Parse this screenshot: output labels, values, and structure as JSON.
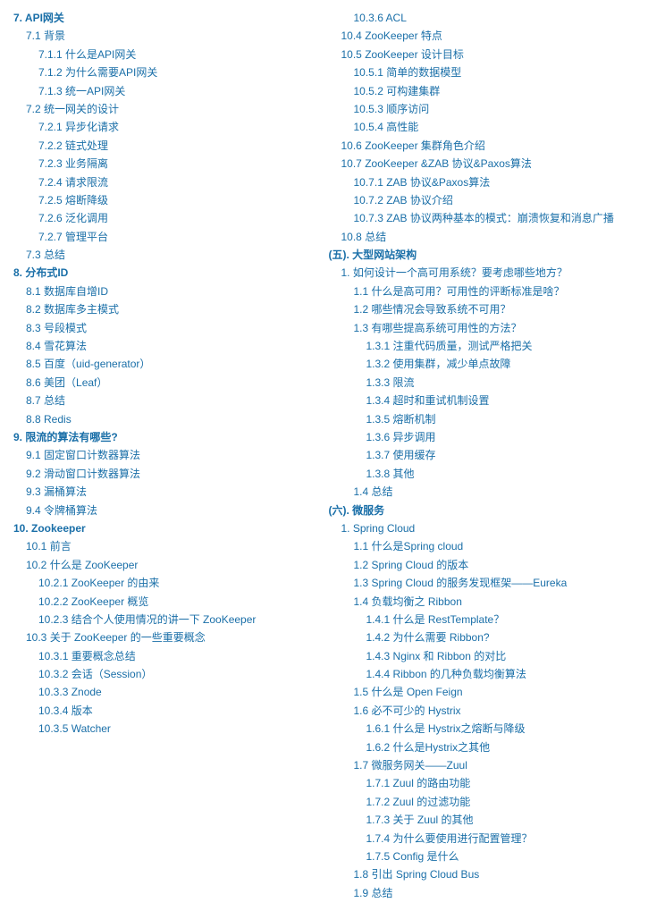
{
  "left_col": [
    {
      "level": 0,
      "text": "7. API网关"
    },
    {
      "level": 1,
      "text": "7.1 背景"
    },
    {
      "level": 2,
      "text": "7.1.1 什么是API网关"
    },
    {
      "level": 2,
      "text": "7.1.2 为什么需要API网关"
    },
    {
      "level": 2,
      "text": "7.1.3 统一API网关"
    },
    {
      "level": 1,
      "text": "7.2 统一网关的设计"
    },
    {
      "level": 2,
      "text": "7.2.1 异步化请求"
    },
    {
      "level": 2,
      "text": "7.2.2 链式处理"
    },
    {
      "level": 2,
      "text": "7.2.3 业务隔离"
    },
    {
      "level": 2,
      "text": "7.2.4 请求限流"
    },
    {
      "level": 2,
      "text": "7.2.5 熔断降级"
    },
    {
      "level": 2,
      "text": "7.2.6 泛化调用"
    },
    {
      "level": 2,
      "text": "7.2.7 管理平台"
    },
    {
      "level": 1,
      "text": "7.3 总结"
    },
    {
      "level": 0,
      "text": "8. 分布式ID"
    },
    {
      "level": 1,
      "text": "8.1 数据库自增ID"
    },
    {
      "level": 1,
      "text": "8.2 数据库多主模式"
    },
    {
      "level": 1,
      "text": "8.3 号段模式"
    },
    {
      "level": 1,
      "text": "8.4 雪花算法"
    },
    {
      "level": 1,
      "text": "8.5 百度（uid-generator）"
    },
    {
      "level": 1,
      "text": "8.6 美团（Leaf）"
    },
    {
      "level": 1,
      "text": "8.7 总结"
    },
    {
      "level": 1,
      "text": "8.8 Redis"
    },
    {
      "level": 0,
      "text": "9. 限流的算法有哪些?"
    },
    {
      "level": 1,
      "text": "9.1 固定窗口计数器算法"
    },
    {
      "level": 1,
      "text": "9.2 滑动窗口计数器算法"
    },
    {
      "level": 1,
      "text": "9.3 漏桶算法"
    },
    {
      "level": 1,
      "text": "9.4 令牌桶算法"
    },
    {
      "level": 0,
      "text": "10. Zookeeper"
    },
    {
      "level": 1,
      "text": "10.1 前言"
    },
    {
      "level": 1,
      "text": "10.2 什么是 ZooKeeper"
    },
    {
      "level": 2,
      "text": "10.2.1 ZooKeeper 的由来"
    },
    {
      "level": 2,
      "text": "10.2.2 ZooKeeper 概览"
    },
    {
      "level": 2,
      "text": "10.2.3 结合个人使用情况的讲一下 ZooKeeper"
    },
    {
      "level": 1,
      "text": "10.3 关于 ZooKeeper 的一些重要概念"
    },
    {
      "level": 2,
      "text": "10.3.1 重要概念总结"
    },
    {
      "level": 2,
      "text": "10.3.2 会话（Session）"
    },
    {
      "level": 2,
      "text": "10.3.3 Znode"
    },
    {
      "level": 2,
      "text": "10.3.4 版本"
    },
    {
      "level": 2,
      "text": "10.3.5 Watcher"
    }
  ],
  "right_col": [
    {
      "level": 2,
      "text": "10.3.6 ACL"
    },
    {
      "level": 1,
      "text": "10.4 ZooKeeper 特点"
    },
    {
      "level": 1,
      "text": "10.5 ZooKeeper 设计目标"
    },
    {
      "level": 2,
      "text": "10.5.1 简单的数据模型"
    },
    {
      "level": 2,
      "text": "10.5.2 可构建集群"
    },
    {
      "level": 2,
      "text": "10.5.3 顺序访问"
    },
    {
      "level": 2,
      "text": "10.5.4 高性能"
    },
    {
      "level": 1,
      "text": "10.6 ZooKeeper 集群角色介绍"
    },
    {
      "level": 1,
      "text": "10.7 ZooKeeper &ZAB 协议&Paxos算法"
    },
    {
      "level": 2,
      "text": "10.7.1 ZAB 协议&Paxos算法"
    },
    {
      "level": 2,
      "text": "10.7.2 ZAB 协议介绍"
    },
    {
      "level": 2,
      "text": "10.7.3 ZAB 协议两种基本的模式：崩溃恢复和消息广播"
    },
    {
      "level": 1,
      "text": "10.8 总结"
    },
    {
      "level": 0,
      "text": "(五). 大型网站架构"
    },
    {
      "level": 1,
      "text": "1. 如何设计一个高可用系统？要考虑哪些地方？"
    },
    {
      "level": 2,
      "text": "1.1 什么是高可用？可用性的评断标准是啥？"
    },
    {
      "level": 2,
      "text": "1.2 哪些情况会导致系统不可用？"
    },
    {
      "level": 2,
      "text": "1.3 有哪些提高系统可用性的方法？"
    },
    {
      "level": 3,
      "text": "1.3.1 注重代码质量，测试严格把关"
    },
    {
      "level": 3,
      "text": "1.3.2 使用集群，减少单点故障"
    },
    {
      "level": 3,
      "text": "1.3.3 限流"
    },
    {
      "level": 3,
      "text": "1.3.4 超时和重试机制设置"
    },
    {
      "level": 3,
      "text": "1.3.5 熔断机制"
    },
    {
      "level": 3,
      "text": "1.3.6 异步调用"
    },
    {
      "level": 3,
      "text": "1.3.7 使用缓存"
    },
    {
      "level": 3,
      "text": "1.3.8 其他"
    },
    {
      "level": 2,
      "text": "1.4 总结"
    },
    {
      "level": 0,
      "text": "(六). 微服务"
    },
    {
      "level": 1,
      "text": "1. Spring Cloud"
    },
    {
      "level": 2,
      "text": "1.1 什么是Spring cloud"
    },
    {
      "level": 2,
      "text": "1.2 Spring Cloud 的版本"
    },
    {
      "level": 2,
      "text": "1.3 Spring Cloud 的服务发现框架——Eureka"
    },
    {
      "level": 2,
      "text": "1.4 负载均衡之 Ribbon"
    },
    {
      "level": 3,
      "text": "1.4.1 什么是 RestTemplate？"
    },
    {
      "level": 3,
      "text": "1.4.2 为什么需要 Ribbon?"
    },
    {
      "level": 3,
      "text": "1.4.3 Nginx 和 Ribbon 的对比"
    },
    {
      "level": 3,
      "text": "1.4.4 Ribbon 的几种负载均衡算法"
    },
    {
      "level": 2,
      "text": "1.5 什么是 Open Feign"
    },
    {
      "level": 2,
      "text": "1.6 必不可少的 Hystrix"
    },
    {
      "level": 3,
      "text": "1.6.1 什么是 Hystrix之熔断与降级"
    },
    {
      "level": 3,
      "text": "1.6.2 什么是Hystrix之其他"
    },
    {
      "level": 2,
      "text": "1.7 微服务网关——Zuul"
    },
    {
      "level": 3,
      "text": "1.7.1 Zuul 的路由功能"
    },
    {
      "level": 3,
      "text": "1.7.2 Zuul 的过滤功能"
    },
    {
      "level": 3,
      "text": "1.7.3 关于 Zuul 的其他"
    },
    {
      "level": 3,
      "text": "1.7.4 为什么要使用进行配置管理？"
    },
    {
      "level": 3,
      "text": "1.7.5 Config 是什么"
    },
    {
      "level": 2,
      "text": "1.8 引出 Spring Cloud Bus"
    },
    {
      "level": 2,
      "text": "1.9 总结"
    }
  ]
}
